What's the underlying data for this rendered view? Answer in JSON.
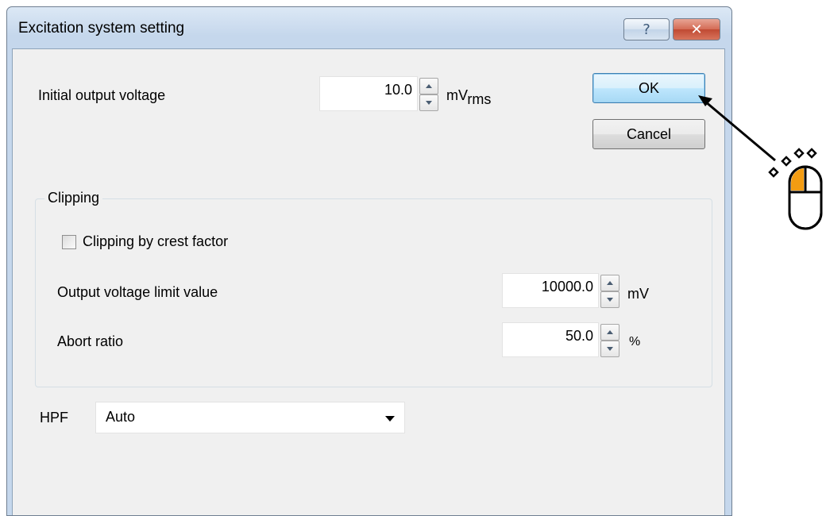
{
  "dialog": {
    "title": "Excitation system setting",
    "help_glyph": "?",
    "close_glyph": "✕"
  },
  "initial_output": {
    "label": "Initial output voltage",
    "value": "10.0",
    "unit_main": "mV",
    "unit_sub": "rms"
  },
  "buttons": {
    "ok": "OK",
    "cancel": "Cancel"
  },
  "clipping": {
    "title": "Clipping",
    "checkbox_label": "Clipping by crest factor",
    "checkbox_checked": false,
    "limit_label": "Output voltage limit value",
    "limit_value": "10000.0",
    "limit_unit": "mV",
    "abort_label": "Abort ratio",
    "abort_value": "50.0",
    "abort_unit": "%"
  },
  "hpf": {
    "label": "HPF",
    "selected": "Auto"
  },
  "colors": {
    "title_gradient_top": "#dce8f5",
    "close_button": "#c04a33",
    "default_button_border": "#3c7fb1",
    "mouse_button_highlight": "#f39c12"
  }
}
